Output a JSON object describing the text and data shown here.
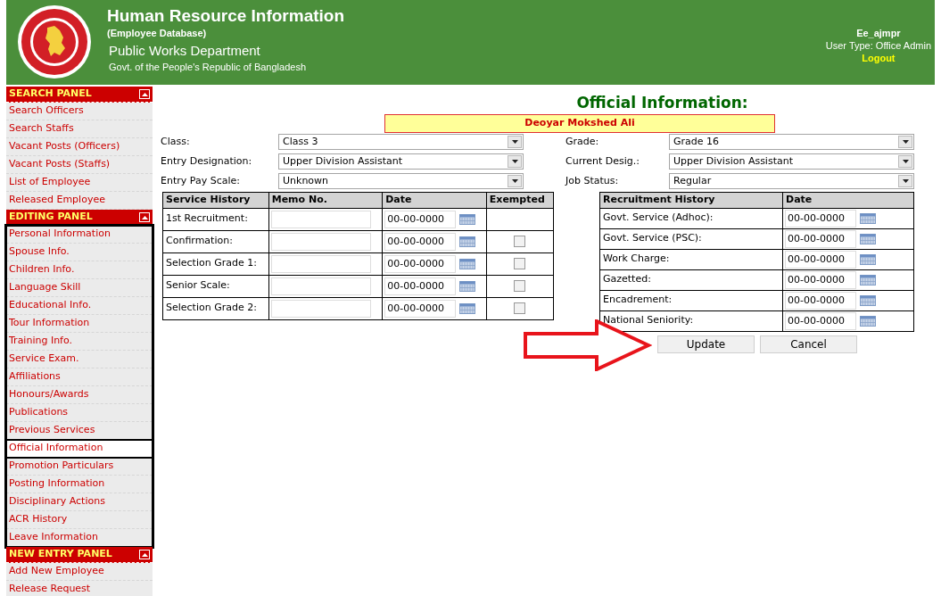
{
  "header": {
    "title": "Human Resource Information",
    "subtitle": "(Employee Database)",
    "department": "Public Works Department",
    "government": "Govt. of the People's Republic of Bangladesh",
    "user_name": "Ee_ajmpr",
    "user_type": "User Type: Office Admin",
    "logout": "Logout"
  },
  "sidebar": [
    {
      "title": "SEARCH PANEL",
      "items": [
        {
          "label": "Search Officers",
          "selected": false
        },
        {
          "label": "Search Staffs",
          "selected": false
        },
        {
          "label": "Vacant Posts (Officers)",
          "selected": false
        },
        {
          "label": "Vacant Posts (Staffs)",
          "selected": false
        },
        {
          "label": "List of Employee",
          "selected": false
        },
        {
          "label": "Released Employee",
          "selected": false
        }
      ]
    },
    {
      "title": "EDITING PANEL",
      "items": [
        {
          "label": "Personal Information",
          "selected": false
        },
        {
          "label": "Spouse Info.",
          "selected": false
        },
        {
          "label": "Children Info.",
          "selected": false
        },
        {
          "label": "Language Skill",
          "selected": false
        },
        {
          "label": "Educational Info.",
          "selected": false
        },
        {
          "label": "Tour Information",
          "selected": false
        },
        {
          "label": "Training Info.",
          "selected": false
        },
        {
          "label": "Service Exam.",
          "selected": false
        },
        {
          "label": "Affiliations",
          "selected": false
        },
        {
          "label": "Honours/Awards",
          "selected": false
        },
        {
          "label": "Publications",
          "selected": false
        },
        {
          "label": "Previous Services",
          "selected": false
        },
        {
          "label": "Official Information",
          "selected": true
        },
        {
          "label": "Promotion Particulars",
          "selected": false
        },
        {
          "label": "Posting Information",
          "selected": false
        },
        {
          "label": "Disciplinary Actions",
          "selected": false
        },
        {
          "label": "ACR History",
          "selected": false
        },
        {
          "label": "Leave Information",
          "selected": false
        }
      ]
    },
    {
      "title": "NEW ENTRY PANEL",
      "items": [
        {
          "label": "Add New Employee",
          "selected": false
        },
        {
          "label": "Release Request",
          "selected": false
        }
      ]
    }
  ],
  "page_title": "Official Information:",
  "employee_name": "Deoyar Mokshed Ali",
  "left_fields": [
    {
      "label": "Class:",
      "value": "Class 3"
    },
    {
      "label": "Entry Designation:",
      "value": "Upper Division Assistant"
    },
    {
      "label": "Entry Pay Scale:",
      "value": "Unknown"
    }
  ],
  "right_fields": [
    {
      "label": "Grade:",
      "value": "Grade 16"
    },
    {
      "label": "Current Desig.:",
      "value": "Upper Division Assistant"
    },
    {
      "label": "Job Status:",
      "value": "Regular"
    }
  ],
  "service_history": {
    "columns": [
      "Service History",
      "Memo No.",
      "Date",
      "Exempted"
    ],
    "rows": [
      {
        "label": "1st Recruitment:",
        "date": "00-00-0000",
        "kind": "plain"
      },
      {
        "label": "Confirmation:",
        "date": "00-00-0000",
        "kind": "exemptable",
        "checked": false
      },
      {
        "label": "Selection Grade 1:",
        "date": "00-00-0000",
        "kind": "exemptable",
        "checked": false
      },
      {
        "label": "Senior Scale:",
        "date": "00-00-0000",
        "kind": "exemptable",
        "checked": false
      },
      {
        "label": "Selection Grade 2:",
        "date": "00-00-0000",
        "kind": "exemptable",
        "checked": false
      }
    ]
  },
  "recruitment_history": {
    "columns": [
      "Recruitment History",
      "Date"
    ],
    "rows": [
      {
        "label": "Govt. Service (Adhoc):",
        "date": "00-00-0000"
      },
      {
        "label": "Govt. Service (PSC):",
        "date": "00-00-0000"
      },
      {
        "label": "Work Charge:",
        "date": "00-00-0000"
      },
      {
        "label": "Gazetted:",
        "date": "00-00-0000"
      },
      {
        "label": "Encadrement:",
        "date": "00-00-0000"
      },
      {
        "label": "National Seniority:",
        "date": "00-00-0000"
      }
    ]
  },
  "buttons": [
    "Update",
    "Cancel"
  ]
}
